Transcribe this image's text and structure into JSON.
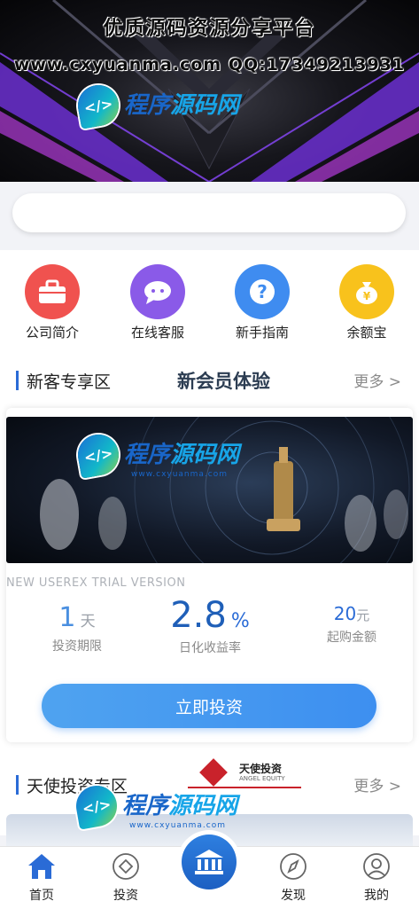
{
  "banner": {
    "line1": "优质源码资源分享平台",
    "line2": "www.cxyuanma.com  QQ:17349213931"
  },
  "watermark": {
    "brand_part1": "程序",
    "brand_part2": "源码网",
    "url": "www.cxyuanma.com"
  },
  "search": {
    "placeholder": ""
  },
  "quick_links": [
    {
      "label": "公司简介",
      "icon": "briefcase-icon",
      "color": "#f0524f"
    },
    {
      "label": "在线客服",
      "icon": "chat-icon",
      "color": "#8a5ae8"
    },
    {
      "label": "新手指南",
      "icon": "question-icon",
      "color": "#3f8cf0"
    },
    {
      "label": "余额宝",
      "icon": "money-bag-icon",
      "color": "#f8c21c"
    }
  ],
  "section_new": {
    "title": "新客专享区",
    "logo_text": "新会员体验",
    "more": "更多 >"
  },
  "product": {
    "subtitle": "NEW USEREX TRIAL VERSION",
    "term_value": "1",
    "term_unit": "天",
    "term_label": "投资期限",
    "rate_value": "2.8",
    "rate_unit": "%",
    "rate_label": "日化收益率",
    "min_value": "20",
    "min_unit": "元",
    "min_label": "起购金额",
    "button": "立即投资"
  },
  "section_angel": {
    "title": "天使投资专区",
    "logo_cn": "天使投资",
    "logo_en": "ANGEL EQUITY",
    "more": "更多 >"
  },
  "nav": {
    "home": "首页",
    "invest": "投资",
    "discover": "发现",
    "mine": "我的"
  },
  "colors": {
    "accent": "#2a6bd6",
    "button": "#4a9af0"
  }
}
